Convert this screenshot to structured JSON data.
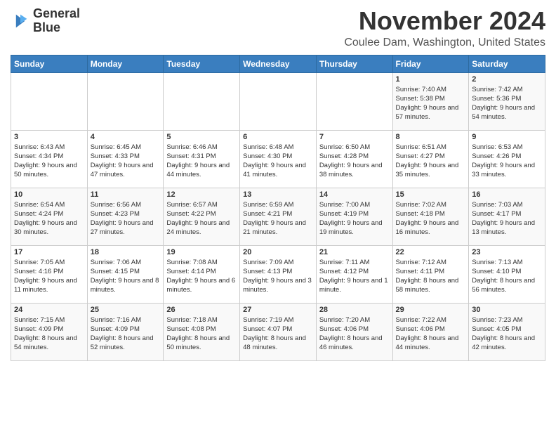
{
  "logo": {
    "line1": "General",
    "line2": "Blue"
  },
  "title": "November 2024",
  "subtitle": "Coulee Dam, Washington, United States",
  "days_of_week": [
    "Sunday",
    "Monday",
    "Tuesday",
    "Wednesday",
    "Thursday",
    "Friday",
    "Saturday"
  ],
  "weeks": [
    [
      {
        "day": "",
        "info": ""
      },
      {
        "day": "",
        "info": ""
      },
      {
        "day": "",
        "info": ""
      },
      {
        "day": "",
        "info": ""
      },
      {
        "day": "",
        "info": ""
      },
      {
        "day": "1",
        "info": "Sunrise: 7:40 AM\nSunset: 5:38 PM\nDaylight: 9 hours and 57 minutes."
      },
      {
        "day": "2",
        "info": "Sunrise: 7:42 AM\nSunset: 5:36 PM\nDaylight: 9 hours and 54 minutes."
      }
    ],
    [
      {
        "day": "3",
        "info": "Sunrise: 6:43 AM\nSunset: 4:34 PM\nDaylight: 9 hours and 50 minutes."
      },
      {
        "day": "4",
        "info": "Sunrise: 6:45 AM\nSunset: 4:33 PM\nDaylight: 9 hours and 47 minutes."
      },
      {
        "day": "5",
        "info": "Sunrise: 6:46 AM\nSunset: 4:31 PM\nDaylight: 9 hours and 44 minutes."
      },
      {
        "day": "6",
        "info": "Sunrise: 6:48 AM\nSunset: 4:30 PM\nDaylight: 9 hours and 41 minutes."
      },
      {
        "day": "7",
        "info": "Sunrise: 6:50 AM\nSunset: 4:28 PM\nDaylight: 9 hours and 38 minutes."
      },
      {
        "day": "8",
        "info": "Sunrise: 6:51 AM\nSunset: 4:27 PM\nDaylight: 9 hours and 35 minutes."
      },
      {
        "day": "9",
        "info": "Sunrise: 6:53 AM\nSunset: 4:26 PM\nDaylight: 9 hours and 33 minutes."
      }
    ],
    [
      {
        "day": "10",
        "info": "Sunrise: 6:54 AM\nSunset: 4:24 PM\nDaylight: 9 hours and 30 minutes."
      },
      {
        "day": "11",
        "info": "Sunrise: 6:56 AM\nSunset: 4:23 PM\nDaylight: 9 hours and 27 minutes."
      },
      {
        "day": "12",
        "info": "Sunrise: 6:57 AM\nSunset: 4:22 PM\nDaylight: 9 hours and 24 minutes."
      },
      {
        "day": "13",
        "info": "Sunrise: 6:59 AM\nSunset: 4:21 PM\nDaylight: 9 hours and 21 minutes."
      },
      {
        "day": "14",
        "info": "Sunrise: 7:00 AM\nSunset: 4:19 PM\nDaylight: 9 hours and 19 minutes."
      },
      {
        "day": "15",
        "info": "Sunrise: 7:02 AM\nSunset: 4:18 PM\nDaylight: 9 hours and 16 minutes."
      },
      {
        "day": "16",
        "info": "Sunrise: 7:03 AM\nSunset: 4:17 PM\nDaylight: 9 hours and 13 minutes."
      }
    ],
    [
      {
        "day": "17",
        "info": "Sunrise: 7:05 AM\nSunset: 4:16 PM\nDaylight: 9 hours and 11 minutes."
      },
      {
        "day": "18",
        "info": "Sunrise: 7:06 AM\nSunset: 4:15 PM\nDaylight: 9 hours and 8 minutes."
      },
      {
        "day": "19",
        "info": "Sunrise: 7:08 AM\nSunset: 4:14 PM\nDaylight: 9 hours and 6 minutes."
      },
      {
        "day": "20",
        "info": "Sunrise: 7:09 AM\nSunset: 4:13 PM\nDaylight: 9 hours and 3 minutes."
      },
      {
        "day": "21",
        "info": "Sunrise: 7:11 AM\nSunset: 4:12 PM\nDaylight: 9 hours and 1 minute."
      },
      {
        "day": "22",
        "info": "Sunrise: 7:12 AM\nSunset: 4:11 PM\nDaylight: 8 hours and 58 minutes."
      },
      {
        "day": "23",
        "info": "Sunrise: 7:13 AM\nSunset: 4:10 PM\nDaylight: 8 hours and 56 minutes."
      }
    ],
    [
      {
        "day": "24",
        "info": "Sunrise: 7:15 AM\nSunset: 4:09 PM\nDaylight: 8 hours and 54 minutes."
      },
      {
        "day": "25",
        "info": "Sunrise: 7:16 AM\nSunset: 4:09 PM\nDaylight: 8 hours and 52 minutes."
      },
      {
        "day": "26",
        "info": "Sunrise: 7:18 AM\nSunset: 4:08 PM\nDaylight: 8 hours and 50 minutes."
      },
      {
        "day": "27",
        "info": "Sunrise: 7:19 AM\nSunset: 4:07 PM\nDaylight: 8 hours and 48 minutes."
      },
      {
        "day": "28",
        "info": "Sunrise: 7:20 AM\nSunset: 4:06 PM\nDaylight: 8 hours and 46 minutes."
      },
      {
        "day": "29",
        "info": "Sunrise: 7:22 AM\nSunset: 4:06 PM\nDaylight: 8 hours and 44 minutes."
      },
      {
        "day": "30",
        "info": "Sunrise: 7:23 AM\nSunset: 4:05 PM\nDaylight: 8 hours and 42 minutes."
      }
    ]
  ]
}
